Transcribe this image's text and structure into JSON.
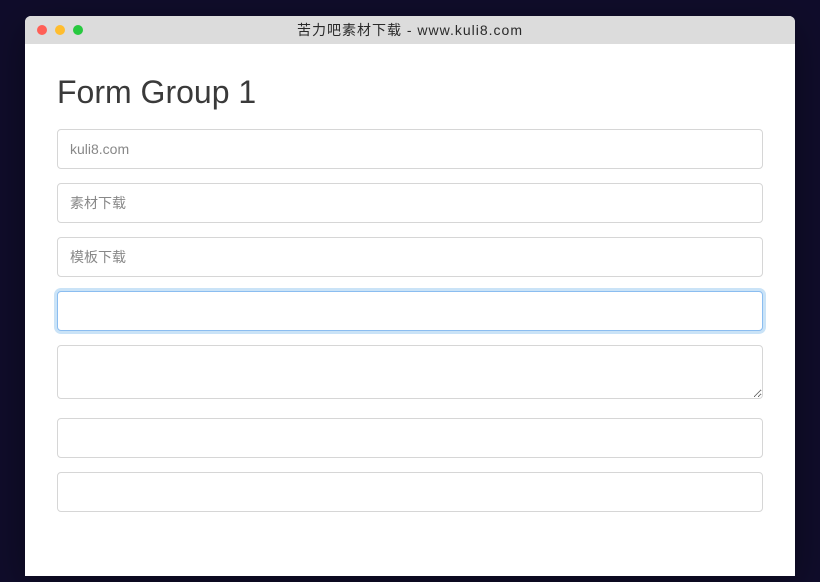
{
  "titlebar": {
    "title": "苦力吧素材下载 - www.kuli8.com"
  },
  "form": {
    "heading": "Form Group 1",
    "fields": [
      {
        "placeholder": "kuli8.com",
        "value": ""
      },
      {
        "placeholder": "素材下载",
        "value": ""
      },
      {
        "placeholder": "模板下载",
        "value": ""
      },
      {
        "placeholder": "",
        "value": "",
        "focused": true
      },
      {
        "placeholder": "",
        "value": "",
        "type": "textarea"
      },
      {
        "placeholder": "",
        "value": ""
      },
      {
        "placeholder": "",
        "value": ""
      }
    ]
  }
}
